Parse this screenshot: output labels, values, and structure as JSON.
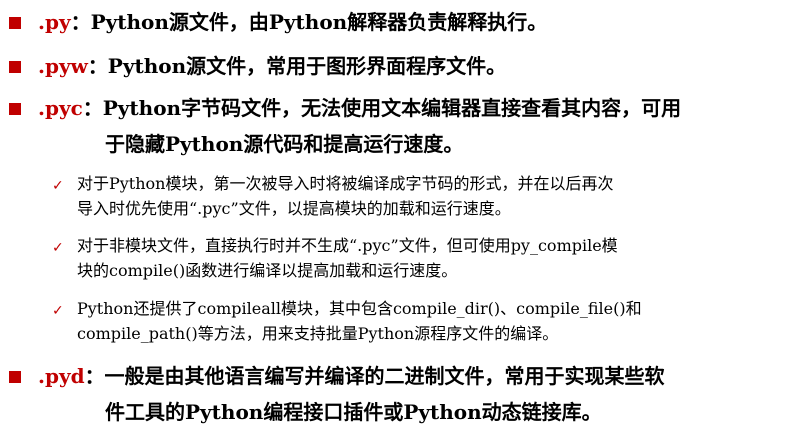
{
  "colors": {
    "accent": "#c00000",
    "text": "#000000"
  },
  "bullets": [
    {
      "ext": ".py",
      "text": "：Python源文件，由Python解释器负责解释执行。"
    },
    {
      "ext": ".pyw",
      "text": "：Python源文件，常用于图形界面程序文件。"
    },
    {
      "ext": ".pyc",
      "text": "：Python字节码文件，无法使用文本编辑器直接查看其内容，可用",
      "cont": "于隐藏Python源代码和提高运行速度。"
    },
    {
      "ext": ".pyd",
      "text": "：一般是由其他语言编写并编译的二进制文件，常用于实现某些软",
      "cont": "件工具的Python编程接口插件或Python动态链接库。"
    }
  ],
  "sub_items": [
    {
      "line1": "对于Python模块，第一次被导入时将被编译成字节码的形式，并在以后再次",
      "line2": "导入时优先使用“.pyc”文件，以提高模块的加载和运行速度。"
    },
    {
      "line1": "对于非模块文件，直接执行时并不生成“.pyc”文件，但可使用py_compile模",
      "line2": "块的compile()函数进行编译以提高加载和运行速度。"
    },
    {
      "line1": "Python还提供了compileall模块，其中包含compile_dir()、compile_file()和",
      "line2": "compile_path()等方法，用来支持批量Python源程序文件的编译。"
    }
  ],
  "check_glyph": "✓"
}
